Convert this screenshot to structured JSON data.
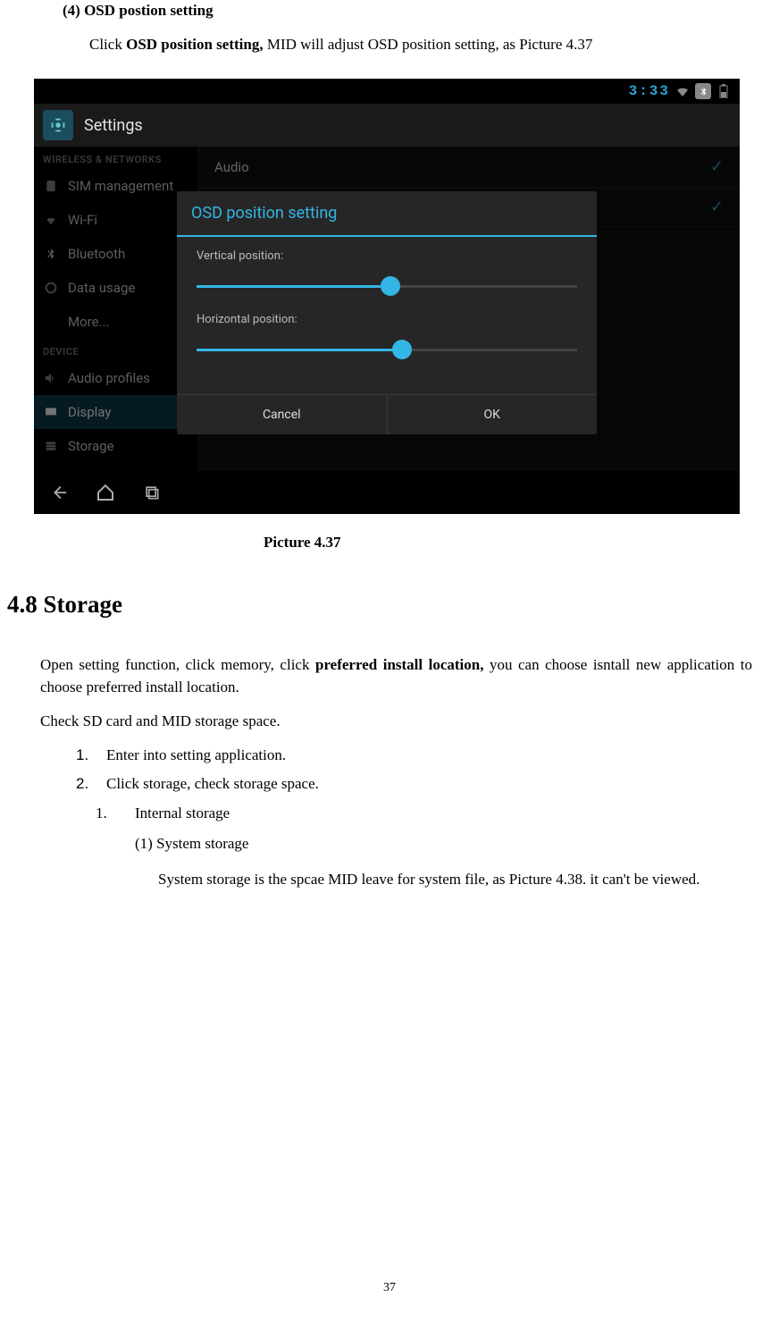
{
  "doc": {
    "item_num": "(4)",
    "item_title": "OSD postion setting",
    "click_pre": "Click ",
    "click_bold": "OSD position setting,",
    "click_post": " MID will adjust OSD position setting, as Picture 4.37",
    "picture_caption": "Picture 4.37",
    "section_heading": "4.8 Storage",
    "para1_pre": "Open setting function, click memory, click ",
    "para1_bold": "preferred install location,",
    "para1_post": " you can choose isntall new application to choose preferred install location.",
    "para2": "Check SD card and MID storage space.",
    "ol1_num": "1.",
    "ol1_text": "Enter into setting application.",
    "ol2_num": "2.",
    "ol2_text": "Click storage, check storage space.",
    "sub1_num": "1.",
    "sub1_text": "Internal storage",
    "subsub1_num": "(1)",
    "subsub1_text": "System storage",
    "subsub_body": "System storage is the spcae MID leave for system file, as Picture 4.38. it can't be viewed.",
    "page_number": "37"
  },
  "statusbar": {
    "time": "3:33"
  },
  "actionbar": {
    "title": "Settings"
  },
  "sidebar": {
    "section1": "WIRELESS & NETWORKS",
    "items1": [
      {
        "label": "SIM management"
      },
      {
        "label": "Wi-Fi"
      },
      {
        "label": "Bluetooth"
      },
      {
        "label": "Data usage"
      },
      {
        "label": "More..."
      }
    ],
    "section2": "DEVICE",
    "items2": [
      {
        "label": "Audio profiles"
      },
      {
        "label": "Display"
      },
      {
        "label": "Storage"
      }
    ]
  },
  "content": {
    "row_audio": "Audio"
  },
  "dialog": {
    "title": "OSD position setting",
    "vert_label": "Vertical position:",
    "horiz_label": "Horizontal position:",
    "cancel": "Cancel",
    "ok": "OK",
    "vert_pct": 51,
    "horiz_pct": 54
  }
}
